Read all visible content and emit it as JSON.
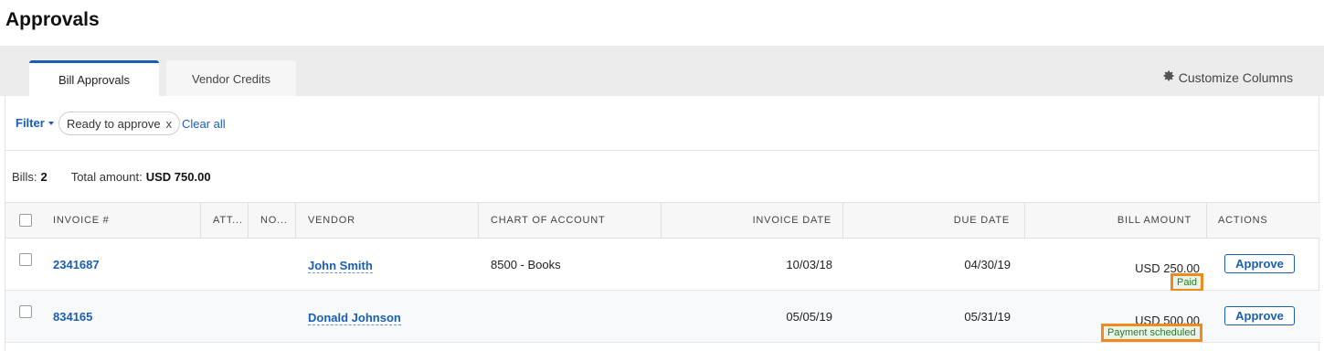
{
  "page": {
    "title": "Approvals"
  },
  "tabs": [
    {
      "label": "Bill Approvals",
      "active": true
    },
    {
      "label": "Vendor Credits",
      "active": false
    }
  ],
  "customize": {
    "label": "Customize Columns",
    "icon": "gear-icon"
  },
  "filter": {
    "label": "Filter",
    "chip_label": "Ready to approve",
    "chip_remove": "x",
    "clear_label": "Clear all"
  },
  "summary": {
    "bills_label": "Bills:",
    "bills_count": "2",
    "total_label": "Total amount:",
    "total_value": "USD 750.00"
  },
  "table": {
    "columns": [
      "INVOICE #",
      "ATT...",
      "NO...",
      "VENDOR",
      "CHART OF ACCOUNT",
      "INVOICE DATE",
      "DUE DATE",
      "BILL AMOUNT",
      "ACTIONS"
    ],
    "rows": [
      {
        "invoice": "2341687",
        "vendor": "John Smith",
        "account": "8500 - Books",
        "invoice_date": "10/03/18",
        "due_date": "04/30/19",
        "amount": "USD 250.00",
        "status": "Paid",
        "action": "Approve"
      },
      {
        "invoice": "834165",
        "vendor": "Donald Johnson",
        "account": "",
        "invoice_date": "05/05/19",
        "due_date": "05/31/19",
        "amount": "USD 500.00",
        "status": "Payment scheduled",
        "action": "Approve"
      }
    ]
  },
  "colors": {
    "accent": "#1a5fb4",
    "highlight": "#f08a1c",
    "status": "#2b7a2b"
  }
}
